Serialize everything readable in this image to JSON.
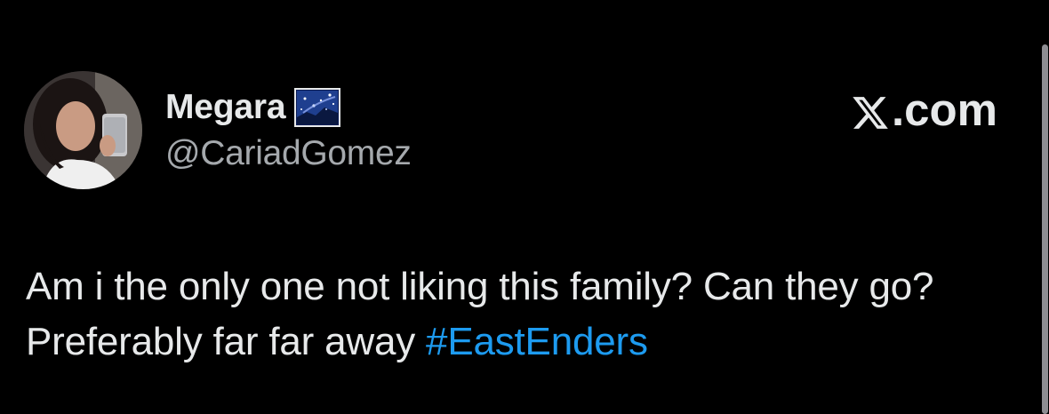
{
  "tweet": {
    "display_name": "Megara",
    "name_emoji": "night-sky-emoji",
    "handle": "@CariadGomez",
    "brand": ".com",
    "brand_icon": "x-logo-icon",
    "text_before_hashtag": "Am i the only one not liking this family? Can they go? Preferably far far away ",
    "hashtag": "#EastEnders"
  },
  "colors": {
    "background": "#000000",
    "text": "#e7e9ea",
    "handle": "#a5a9ad",
    "hashtag": "#1d9bf0",
    "scrollbar": "#8e8e93"
  }
}
